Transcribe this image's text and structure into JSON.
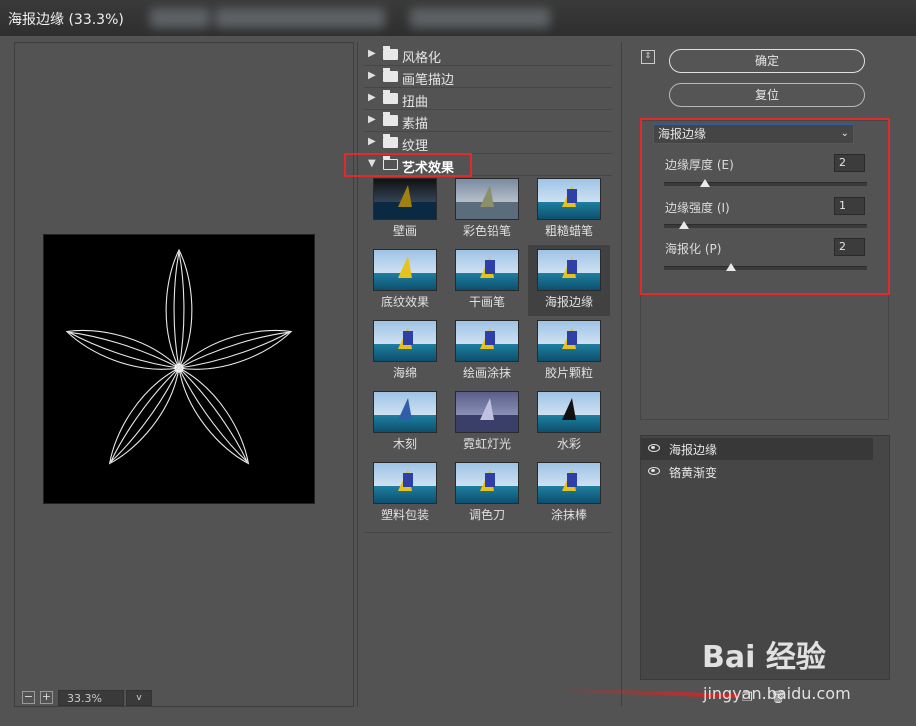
{
  "window": {
    "title": "海报边缘 (33.3%)"
  },
  "preview": {
    "zoom_out": "−",
    "zoom_in": "+",
    "zoom_value": "33.3%",
    "zoom_dropdown": "v"
  },
  "gallery": {
    "folders": [
      {
        "label": "风格化",
        "expanded": false
      },
      {
        "label": "画笔描边",
        "expanded": false
      },
      {
        "label": "扭曲",
        "expanded": false
      },
      {
        "label": "素描",
        "expanded": false
      },
      {
        "label": "纹理",
        "expanded": false
      },
      {
        "label": "艺术效果",
        "expanded": true
      }
    ],
    "filters": [
      "壁画",
      "彩色铅笔",
      "粗糙蜡笔",
      "底纹效果",
      "干画笔",
      "海报边缘",
      "海绵",
      "绘画涂抹",
      "胶片颗粒",
      "木刻",
      "霓虹灯光",
      "水彩",
      "塑料包装",
      "调色刀",
      "涂抹棒"
    ],
    "selected_filter": "海报边缘"
  },
  "buttons": {
    "ok": "确定",
    "reset": "复位"
  },
  "settings": {
    "filter_select": "海报边缘",
    "params": [
      {
        "label": "边缘厚度 (E)",
        "value": "2",
        "level": 0.2
      },
      {
        "label": "边缘强度 (I)",
        "value": "1",
        "level": 0.1
      },
      {
        "label": "海报化 (P)",
        "value": "2",
        "level": 0.33
      }
    ]
  },
  "layers": [
    {
      "name": "海报边缘",
      "visible": true,
      "active": true
    },
    {
      "name": "铬黄渐变",
      "visible": true,
      "active": false
    }
  ],
  "watermark": {
    "brand": "Bai 经验",
    "url": "jingyan.baidu.com"
  },
  "colors": {
    "highlight_red": "#e02b2b",
    "dialog_bg": "#535353"
  }
}
